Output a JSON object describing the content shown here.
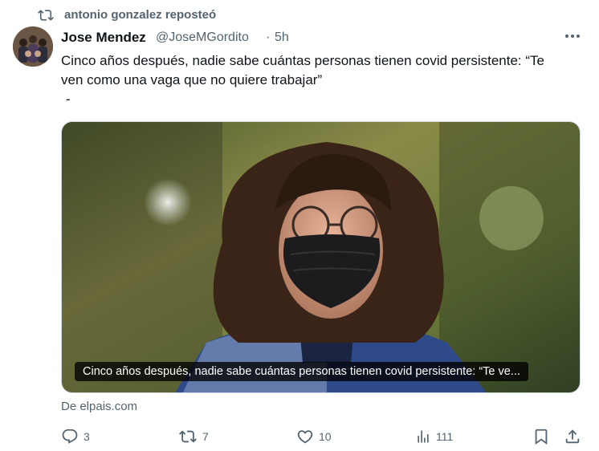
{
  "repost": {
    "icon": "repost-icon",
    "label": "antonio gonzalez reposteó"
  },
  "tweet": {
    "author_name": "Jose Mendez",
    "author_handle": "@JoseMGordito",
    "separator": "·",
    "time": "5h",
    "text_line1": "Cinco años después, nadie sabe cuántas personas tienen covid persistente: “Te",
    "text_line2": "ven como una vaga que no quiere trabajar”",
    "text_line3": "-",
    "media_caption": "Cinco años después, nadie sabe cuántas personas tienen covid persistente: “Te ve...",
    "source": "De elpais.com"
  },
  "actions": {
    "replies": "3",
    "reposts": "7",
    "likes": "10",
    "views": "111"
  },
  "colors": {
    "muted": "#536471",
    "text": "#0f1419",
    "border": "#cfd9de"
  }
}
